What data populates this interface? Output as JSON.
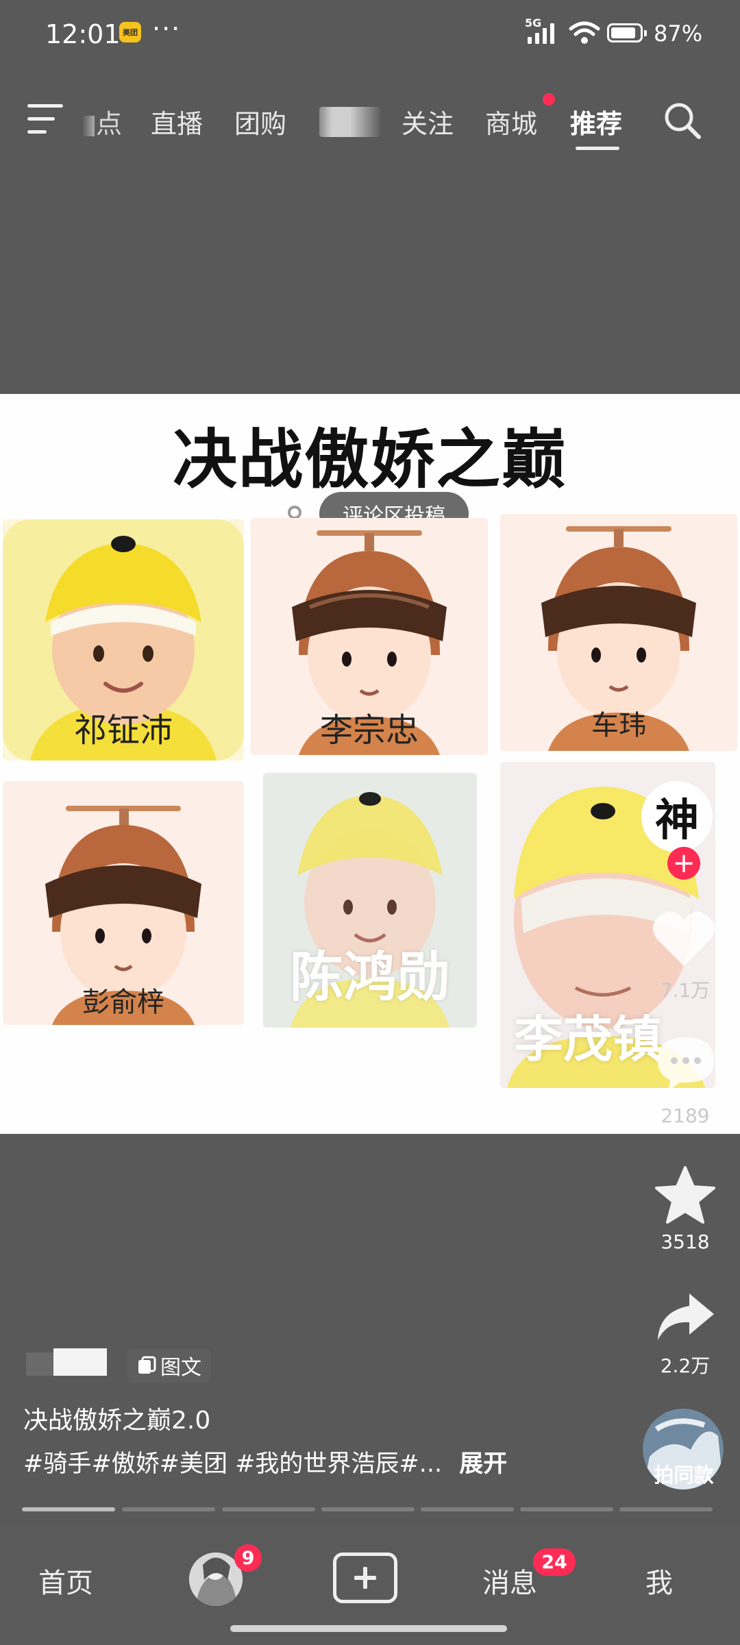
{
  "status_bar": {
    "time": "12:01",
    "app_badge": "美团",
    "more": "···",
    "network": "5G",
    "battery": "87%"
  },
  "top_nav": {
    "tabs": [
      "点",
      "直播",
      "团购",
      "",
      "关注",
      "商城",
      "推荐"
    ],
    "active_tab": "推荐"
  },
  "post": {
    "headline": "决战傲娇之巅",
    "submit_chip": "评论区投稿",
    "riders": [
      "祁钲沛",
      "李宗忠",
      "车玮",
      "彭俞梓",
      "陈鸿勋",
      "李茂镇"
    ]
  },
  "actions": {
    "follow_char": "神",
    "likes": "7.1万",
    "comments": "2189",
    "favorites": "3518",
    "shares": "2.2万",
    "same_style": "拍同款"
  },
  "caption": {
    "type_badge": "图文",
    "title": "决战傲娇之巅2.0",
    "tags": "#骑手#傲娇#美团 #我的世界浩辰#...",
    "expand": "展开"
  },
  "bottom_nav": {
    "home": "首页",
    "friends_badge": "9",
    "messages": "消息",
    "messages_badge": "24",
    "me": "我"
  },
  "colors": {
    "accent_red": "#fe2c55",
    "helmet_yellow": "#f5d93a",
    "goggle_brown": "#5a3a28"
  }
}
